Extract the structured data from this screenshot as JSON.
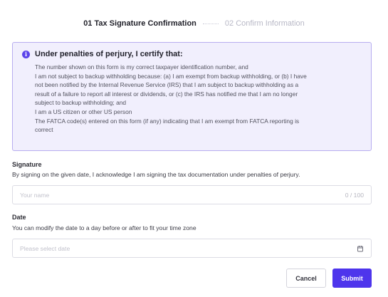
{
  "stepper": {
    "step1": "01 Tax Signature Confirmation",
    "step2": "02 Confirm Information"
  },
  "notice": {
    "title": "Under penalties of perjury, I certify that:",
    "lines": [
      "The number shown on this form is my correct taxpayer identification number, and",
      "I am not subject to backup withholding because: (a) I am exempt from backup withholding, or (b) I have",
      "not been notified by the Internal Revenue Service (IRS) that I am subject to backup withholding as a",
      "result of a failure to report all interest or dividends, or (c) the IRS has notified me that I am no longer",
      "subject to backup withholding; and",
      "I am a US citizen or other US person",
      "The FATCA code(s) entered on this form (if any) indicating that I am exempt from FATCA reporting is",
      "correct"
    ]
  },
  "signature": {
    "label": "Signature",
    "description": "By signing on the given date, I acknowledge I am signing the tax documentation under penalties of perjury.",
    "placeholder": "Your name",
    "counter": "0 / 100"
  },
  "date": {
    "label": "Date",
    "description": "You can modify the date to a day before or after to fit your time zone",
    "placeholder": "Please select date"
  },
  "actions": {
    "cancel": "Cancel",
    "submit": "Submit"
  },
  "colors": {
    "accent": "#4e35ec",
    "notice_bg": "#f1effd",
    "notice_border": "#b7adef"
  },
  "icons": {
    "notice": "info-icon",
    "date": "calendar-icon"
  }
}
